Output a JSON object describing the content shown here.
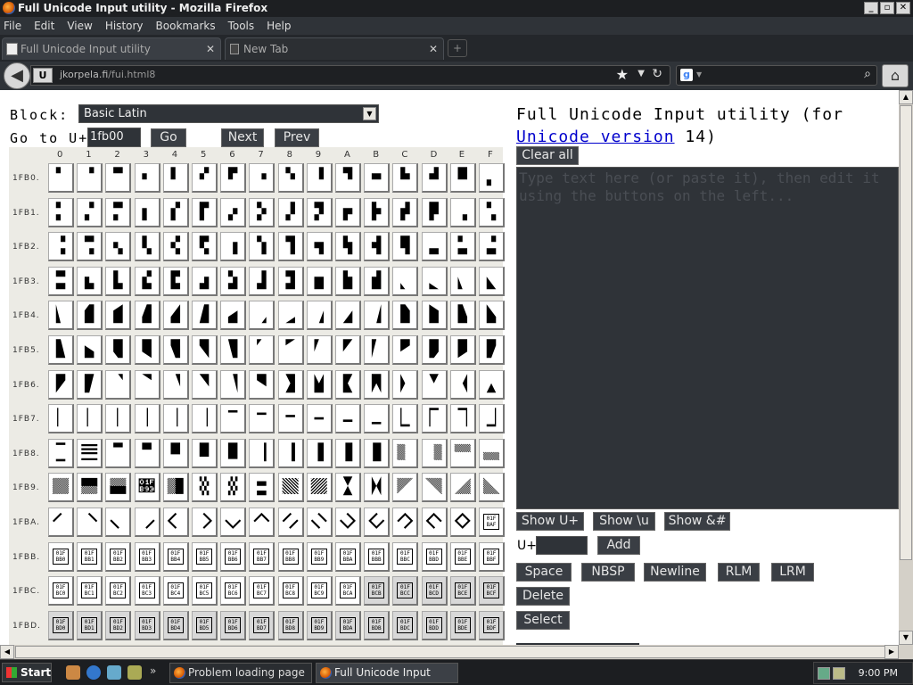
{
  "window": {
    "title": "Full Unicode Input utility - Mozilla Firefox",
    "controls": [
      "_",
      "▫",
      "✕"
    ]
  },
  "menu": [
    "File",
    "Edit",
    "View",
    "History",
    "Bookmarks",
    "Tools",
    "Help"
  ],
  "tabs": [
    {
      "label": "Full Unicode Input utility",
      "close": "✕"
    },
    {
      "label": "New Tab",
      "close": "✕"
    }
  ],
  "newtab_label": "+",
  "navbar": {
    "url_host": "jkorpela.fi",
    "url_path": "/fui.html8",
    "site_icon": "U",
    "back": "◀",
    "star": "★",
    "dropdown": "▼",
    "reload": "↻",
    "search_engine": "g",
    "search_dd": "▼",
    "search": "⌕",
    "home": "⌂"
  },
  "page": {
    "block_label": "Block:",
    "block_value": "Basic Latin",
    "goto_label": "Go to U+",
    "goto_value": "1fb00",
    "go_label": "Go",
    "next_label": "Next",
    "prev_label": "Prev",
    "title_part1": "Full Unicode Input utility (for",
    "title_link": "Unicode version",
    "title_part2": " 14)",
    "clear_label": "Clear all",
    "textarea_text": "Type text here (or paste it), then edit it using the buttons on the left...",
    "show_u_label": "Show U+",
    "show_backslash_label": "Show \\u",
    "show_amp_label": "Show &#",
    "uplus_label": "U+",
    "add_label": "Add",
    "space_label": "Space",
    "nbsp_label": "NBSP",
    "newline_label": "Newline",
    "rlm_label": "RLM",
    "lrm_label": "LRM",
    "delete_label": "Delete",
    "select_label": "Select"
  },
  "grid": {
    "columns": [
      "0",
      "1",
      "2",
      "3",
      "4",
      "5",
      "6",
      "7",
      "8",
      "9",
      "A",
      "B",
      "C",
      "D",
      "E",
      "F"
    ],
    "rows": [
      {
        "label": "1FB0.",
        "chars": [
          "🬀",
          "🬁",
          "🬂",
          "🬃",
          "🬄",
          "🬅",
          "🬆",
          "🬇",
          "🬈",
          "🬉",
          "🬊",
          "🬋",
          "🬌",
          "🬍",
          "🬎",
          "🬏"
        ]
      },
      {
        "label": "1FB1.",
        "chars": [
          "🬐",
          "🬑",
          "🬒",
          "🬓",
          "🬔",
          "🬕",
          "🬖",
          "🬗",
          "🬘",
          "🬙",
          "🬚",
          "🬛",
          "🬜",
          "🬝",
          "🬞",
          "🬟"
        ]
      },
      {
        "label": "1FB2.",
        "chars": [
          "🬠",
          "🬡",
          "🬢",
          "🬣",
          "🬤",
          "🬥",
          "🬦",
          "🬧",
          "🬨",
          "🬩",
          "🬪",
          "🬫",
          "🬬",
          "🬭",
          "🬮",
          "🬯"
        ]
      },
      {
        "label": "1FB3.",
        "chars": [
          "🬰",
          "🬱",
          "🬲",
          "🬳",
          "🬴",
          "🬵",
          "🬶",
          "🬷",
          "🬸",
          "🬹",
          "🬺",
          "🬻",
          "🬼",
          "🬽",
          "🬾",
          "🬿"
        ]
      },
      {
        "label": "1FB4.",
        "chars": [
          "🭀",
          "🭁",
          "🭂",
          "🭃",
          "🭄",
          "🭅",
          "🭆",
          "🭇",
          "🭈",
          "🭉",
          "🭊",
          "🭋",
          "🭌",
          "🭍",
          "🭎",
          "🭏"
        ]
      },
      {
        "label": "1FB5.",
        "chars": [
          "🭐",
          "🭑",
          "🭒",
          "🭓",
          "🭔",
          "🭕",
          "🭖",
          "🭗",
          "🭘",
          "🭙",
          "🭚",
          "🭛",
          "🭜",
          "🭝",
          "🭞",
          "🭟"
        ]
      },
      {
        "label": "1FB6.",
        "chars": [
          "🭠",
          "🭡",
          "🭢",
          "🭣",
          "🭤",
          "🭥",
          "🭦",
          "🭧",
          "🭨",
          "🭩",
          "🭪",
          "🭫",
          "🭬",
          "🭭",
          "🭮",
          "🭯"
        ]
      },
      {
        "label": "1FB7.",
        "chars": [
          "🭰",
          "🭱",
          "🭲",
          "🭳",
          "🭴",
          "🭵",
          "🭶",
          "🭷",
          "🭸",
          "🭹",
          "🭺",
          "🭻",
          "🭼",
          "🭽",
          "🭾",
          "🭿"
        ]
      },
      {
        "label": "1FB8.",
        "chars": [
          "🮀",
          "🮁",
          "🮂",
          "🮃",
          "🮄",
          "🮅",
          "🮆",
          "🮇",
          "🮈",
          "🮉",
          "🮊",
          "🮋",
          "🮌",
          "🮍",
          "🮎",
          "🮏"
        ]
      },
      {
        "label": "1FB9.",
        "chars": [
          "🮐",
          "🮑",
          "🮒",
          "🮓",
          "🮔",
          "🮕",
          "🮖",
          "🮗",
          "🮘",
          "🮙",
          "🮚",
          "🮛",
          "🮜",
          "🮝",
          "🮞",
          "🮟"
        ]
      },
      {
        "label": "1FBA.",
        "chars": [
          "🮠",
          "🮡",
          "🮢",
          "🮣",
          "🮤",
          "🮥",
          "🮦",
          "🮧",
          "🮨",
          "🮩",
          "🮪",
          "🮫",
          "🮬",
          "🮭",
          "🮮",
          "01F BAF"
        ]
      },
      {
        "label": "1FBB.",
        "chars": [
          "01F BB0",
          "01F BB1",
          "01F BB2",
          "01F BB3",
          "01F BB4",
          "01F BB5",
          "01F BB6",
          "01F BB7",
          "01F BB8",
          "01F BB9",
          "01F BBA",
          "01F BBB",
          "01F BBC",
          "01F BBD",
          "01F BBE",
          "01F BBF"
        ]
      },
      {
        "label": "1FBC.",
        "chars": [
          "01F BC0",
          "01F BC1",
          "01F BC2",
          "01F BC3",
          "01F BC4",
          "01F BC5",
          "01F BC6",
          "01F BC7",
          "01F BC8",
          "01F BC9",
          "01F BCA",
          "01F BCB",
          "01F BCC",
          "01F BCD",
          "01F BCE",
          "01F BCF"
        ]
      },
      {
        "label": "1FBD.",
        "chars": [
          "01F BD0",
          "01F BD1",
          "01F BD2",
          "01F BD3",
          "01F BD4",
          "01F BD5",
          "01F BD6",
          "01F BD7",
          "01F BD8",
          "01F BD9",
          "01F BDA",
          "01F BDB",
          "01F BDC",
          "01F BDD",
          "01F BDE",
          "01F BDF"
        ]
      }
    ]
  },
  "taskbar": {
    "start_label": "Start",
    "more": "»",
    "tasks": [
      {
        "label": "Problem loading page (K-..."
      },
      {
        "label": "Full Unicode Input utili..."
      }
    ],
    "clock": "9:00 PM"
  },
  "scroll": {
    "up": "▲",
    "down": "▼",
    "left": "◀",
    "right": "▶",
    "block_dropdown": "▼"
  }
}
